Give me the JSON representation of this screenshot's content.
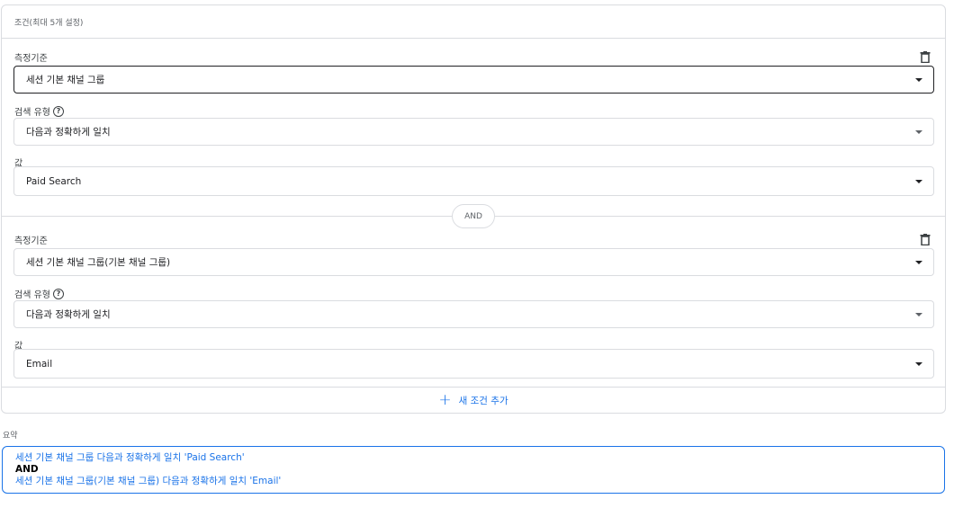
{
  "header": {
    "title": "조건(최대 5개 설정)"
  },
  "conditions": [
    {
      "dimension_label": "측정기준",
      "dimension_value": "세션 기본 채널 그룹",
      "match_label": "검색 유형",
      "match_value": "다음과 정확하게 일치",
      "value_label": "값",
      "value_value": "Paid Search"
    },
    {
      "dimension_label": "측정기준",
      "dimension_value": "세션 기본 채널 그룹(기본 채널 그룹)",
      "match_label": "검색 유형",
      "match_value": "다음과 정확하게 일치",
      "value_label": "값",
      "value_value": "Email"
    }
  ],
  "and_label": "AND",
  "help_glyph": "?",
  "add_condition": {
    "icon": "+",
    "label": "새 조건 추가"
  },
  "summary": {
    "label": "요약",
    "line1": "세션 기본 채널 그룹 다음과 정확하게 일치 'Paid Search'",
    "and": "AND",
    "line2": "세션 기본 채널 그룹(기본 채널 그룹) 다음과 정확하게 일치 'Email'"
  },
  "colors": {
    "accent": "#1a73e8",
    "border": "#dadce0",
    "text": "#202124"
  }
}
